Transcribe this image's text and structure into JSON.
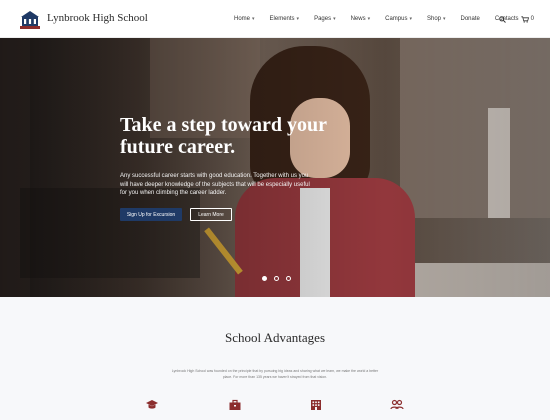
{
  "header": {
    "brand": "Lynbrook High School",
    "logo_text": "LYNBROOK",
    "nav": [
      {
        "label": "Home",
        "dropdown": true
      },
      {
        "label": "Elements",
        "dropdown": true
      },
      {
        "label": "Pages",
        "dropdown": true
      },
      {
        "label": "News",
        "dropdown": true
      },
      {
        "label": "Campus",
        "dropdown": true
      },
      {
        "label": "Shop",
        "dropdown": true
      },
      {
        "label": "Donate",
        "dropdown": false
      },
      {
        "label": "Contacts",
        "dropdown": false
      }
    ],
    "cart_count": "0",
    "icons": {
      "search": "search-icon",
      "cart": "cart-icon"
    }
  },
  "hero": {
    "title": "Take a step toward your future career.",
    "text": "Any successful career starts with good education. Together with us you will have deeper knowledge of the subjects that will be especially useful for you when climbing the career ladder.",
    "primary_button": "Sign Up for Excursion",
    "secondary_button": "Learn More",
    "slides": 3,
    "active_slide": 1
  },
  "advantages": {
    "title": "School Advantages",
    "text": "Lynbrook High School was founded on the principle that by pursuing big ideas and sharing what we learn, we make the world a better place. For more than 135 years we haven't strayed from that vision.",
    "icons": [
      "graduation-cap-icon",
      "briefcase-icon",
      "building-icon",
      "people-icon"
    ]
  },
  "colors": {
    "primary": "#1f3a66",
    "accent": "#8b2d2d",
    "text_dark": "#2b2b2b",
    "section_bg": "#f7f8fa"
  }
}
